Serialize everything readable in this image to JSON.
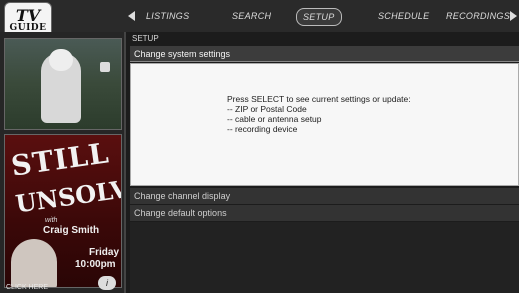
{
  "logo": {
    "line1": "TV",
    "line2": "GUIDE"
  },
  "nav": {
    "tabs": [
      {
        "label": "LISTINGS"
      },
      {
        "label": "SEARCH"
      },
      {
        "label": "SETUP"
      },
      {
        "label": "SCHEDULE"
      },
      {
        "label": "RECORDINGS"
      }
    ],
    "active_tab": "SETUP"
  },
  "ad_panel": {
    "promo_title_1": "STILL",
    "promo_title_2": "UNSOLVED",
    "with_label": "with",
    "host": "Craig Smith",
    "day": "Friday",
    "time": "10:00pm",
    "click_here": "CLICK HERE"
  },
  "main": {
    "breadcrumb": "SETUP",
    "selected_option": "Change system settings",
    "info": {
      "lead": "Press SELECT to see current settings or update:",
      "items": [
        "-- ZIP or Postal Code",
        "-- cable or antenna setup",
        "-- recording device"
      ]
    },
    "options": [
      "Change channel display",
      "Change default options"
    ]
  }
}
